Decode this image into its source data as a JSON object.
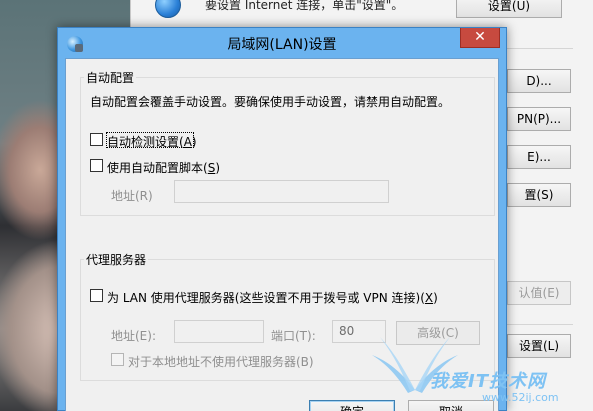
{
  "background": {
    "top_text": "要设置 Internet 连接，单击\"设置\"。",
    "buttons": [
      {
        "label": "设置(U)",
        "disabled": false
      },
      {
        "label": "D)...",
        "disabled": false
      },
      {
        "label": "PN(P)...",
        "disabled": false
      },
      {
        "label": "E)...",
        "disabled": false
      },
      {
        "label": "置(S)",
        "disabled": false
      },
      {
        "label": "认值(E)",
        "disabled": true
      },
      {
        "label": "设置(L)",
        "disabled": false
      }
    ]
  },
  "dialog": {
    "title": "局域网(LAN)设置",
    "close_glyph": "✕",
    "auto_config": {
      "caption": "自动配置",
      "description": "自动配置会覆盖手动设置。要确保使用手动设置，请禁用自动配置。",
      "auto_detect": {
        "label": "自动检测设置(",
        "mnemonic": "A",
        "suffix": ")",
        "checked": false
      },
      "use_script": {
        "label": "使用自动配置脚本(",
        "mnemonic": "S",
        "suffix": ")",
        "checked": false
      },
      "address_label": "地址(R)",
      "address_value": ""
    },
    "proxy": {
      "caption": "代理服务器",
      "use_proxy": {
        "label": "为 LAN 使用代理服务器(这些设置不用于拨号或 VPN 连接)(",
        "mnemonic": "X",
        "suffix": ")",
        "checked": false
      },
      "address_label": "地址(E):",
      "address_value": "",
      "port_label": "端口(T):",
      "port_value": "80",
      "advanced_label": "高级(C)",
      "bypass_local": {
        "label": "对于本地地址不使用代理服务器(B)",
        "checked": false
      }
    },
    "ok_label": "确定",
    "cancel_label": "取消"
  },
  "watermark": {
    "text": "我爱IT技术网",
    "sub": "www.52ij.com"
  }
}
